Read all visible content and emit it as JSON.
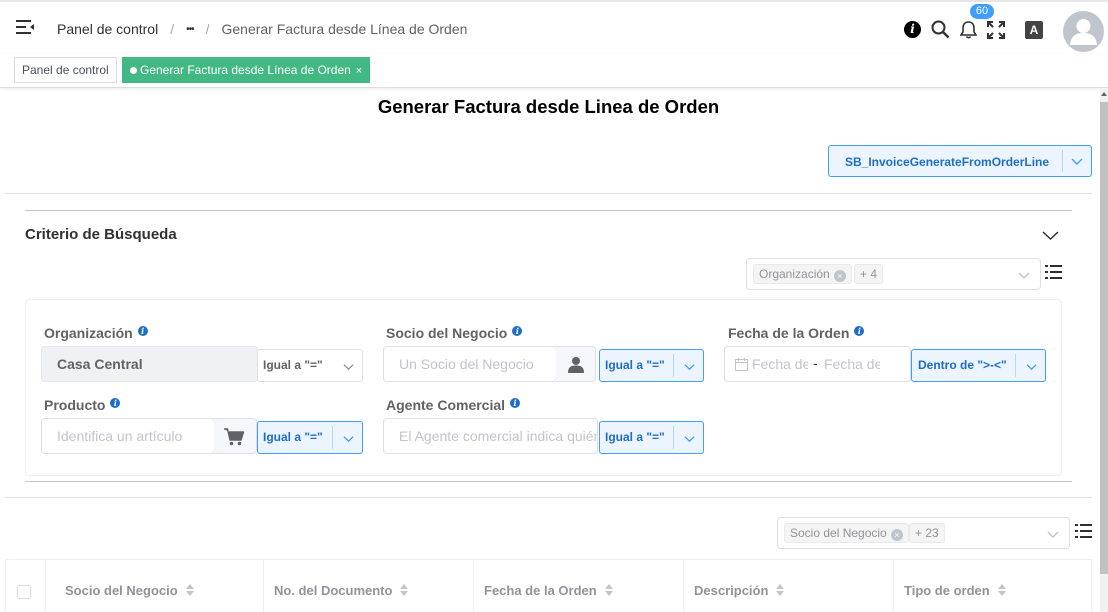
{
  "header": {
    "breadcrumb": {
      "home": "Panel de control",
      "ellipsis": "•••",
      "current": "Generar Factura desde Línea de Orden"
    },
    "notifications_count": "60",
    "icons": [
      "menu-fold-icon",
      "info-icon",
      "search-icon",
      "bell-icon",
      "fullscreen-icon",
      "language-icon",
      "user-avatar-icon"
    ]
  },
  "tags": [
    {
      "label": "Panel de control",
      "active": false
    },
    {
      "label": "Generar Factura desde Línea de Orden",
      "active": true,
      "close": "×"
    }
  ],
  "page": {
    "title": "Generar Factura desde Linea de Orden",
    "process_value": "SB_InvoiceGenerateFromOrderLine"
  },
  "criteria": {
    "title": "Criterio de Búsqueda",
    "field_selector": {
      "tag": "Organización",
      "more": "+ 4"
    },
    "fields": {
      "organization": {
        "label": "Organización",
        "value": "Casa Central",
        "operator": "Igual a \"=\""
      },
      "business_partner": {
        "label": "Socio del Negocio",
        "placeholder": "Un Socio del Negocio",
        "operator": "Igual a \"=\""
      },
      "order_date": {
        "label": "Fecha de la Orden",
        "placeholder_from": "Fecha de",
        "separator": "-",
        "placeholder_to": "Fecha de",
        "operator": "Dentro de \">-<\""
      },
      "product": {
        "label": "Producto",
        "placeholder": "Identifica un artículo",
        "operator": "Igual a \"=\""
      },
      "sales_rep": {
        "label": "Agente Comercial",
        "placeholder": "El Agente comercial indica quién",
        "operator": "Igual a \"=\""
      }
    }
  },
  "table": {
    "column_selector": {
      "tag": "Socio del Negocio",
      "more": "+ 23"
    },
    "columns": [
      "Socio del Negocio",
      "No. del Documento",
      "Fecha de la Orden",
      "Descripción",
      "Tipo de orden"
    ]
  },
  "colors": {
    "accent": "#409eff",
    "active_tag": "#42b983",
    "text": "#303133"
  }
}
